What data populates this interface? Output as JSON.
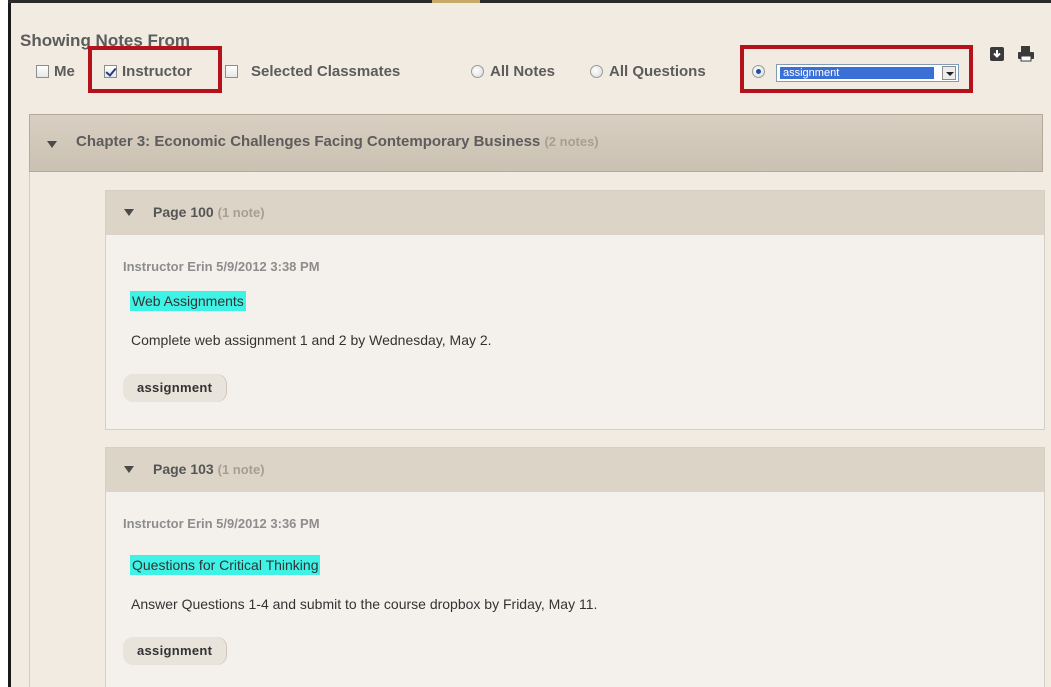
{
  "filter": {
    "title": "Showing Notes From",
    "me_label": "Me",
    "instructor_label": "Instructor",
    "classmates_label": "Selected Classmates",
    "all_notes_label": "All Notes",
    "all_questions_label": "All Questions",
    "tag_select_value": "assignment",
    "instructor_checked": true,
    "me_checked": false,
    "classmates_checked": false,
    "selected_radio": "tag"
  },
  "toolbar": {
    "download_icon": "download-icon",
    "print_icon": "print-icon"
  },
  "chapter": {
    "title": "Chapter 3: Economic Challenges Facing Contemporary Business",
    "count": "(2 notes)"
  },
  "pages": [
    {
      "title": "Page 100",
      "count": "(1 note)",
      "meta": "Instructor Erin 5/9/2012 3:38 PM",
      "note_title": "Web Assignments",
      "note_body": "Complete web assignment 1 and 2 by Wednesday, May 2.",
      "tag": "assignment"
    },
    {
      "title": "Page 103",
      "count": "(1 note)",
      "meta": "Instructor Erin 5/9/2012 3:36 PM",
      "note_title": "Questions for Critical Thinking",
      "note_body": "Answer Questions 1-4 and submit to the course dropbox by Friday, May 11.",
      "tag": "assignment"
    }
  ],
  "colors": {
    "highlight_box": "#b5121b",
    "note_title_highlight": "#3ff2e6",
    "panel_bg": "#f1ebe1",
    "header_bg": "#dcd4c7"
  }
}
